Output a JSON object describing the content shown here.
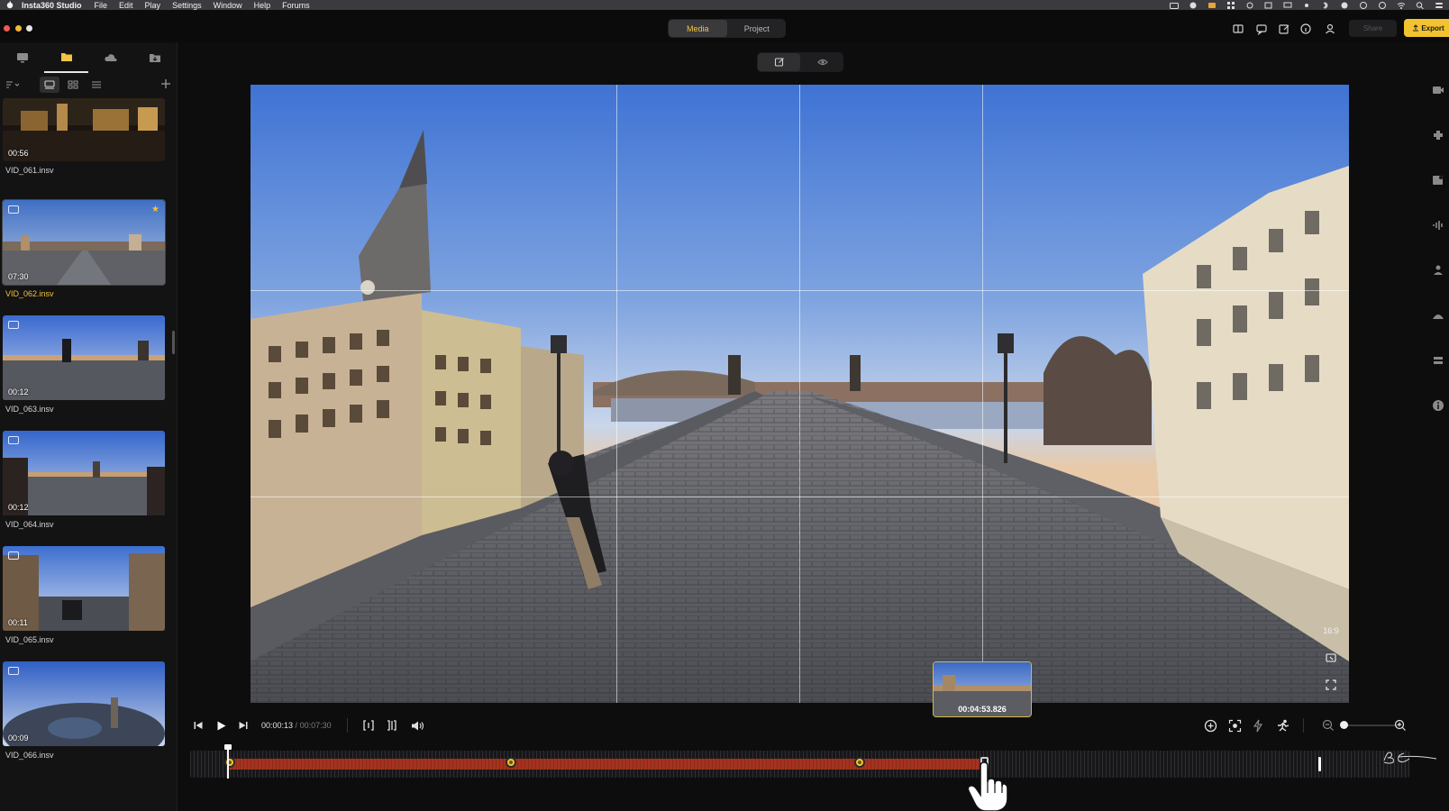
{
  "menubar": {
    "app_name": "Insta360 Studio",
    "items": [
      "File",
      "Edit",
      "Play",
      "Settings",
      "Window",
      "Help",
      "Forums"
    ]
  },
  "titlebar": {
    "tabs": [
      {
        "label": "Media",
        "active": true
      },
      {
        "label": "Project",
        "active": false
      }
    ],
    "share_label": "Share",
    "export_label": "Export"
  },
  "clips": [
    {
      "name": "VID_061.insv",
      "duration": "00:56",
      "selected": false,
      "starred": false
    },
    {
      "name": "VID_062.insv",
      "duration": "07:30",
      "selected": true,
      "starred": true
    },
    {
      "name": "VID_063.insv",
      "duration": "00:12",
      "selected": false,
      "starred": false
    },
    {
      "name": "VID_064.insv",
      "duration": "00:12",
      "selected": false,
      "starred": false
    },
    {
      "name": "VID_065.insv",
      "duration": "00:11",
      "selected": false,
      "starred": false
    },
    {
      "name": "VID_066.insv",
      "duration": "00:09",
      "selected": false,
      "starred": false
    }
  ],
  "viewer": {
    "aspect_label": "16:9"
  },
  "playback": {
    "current_time": "00:00:13",
    "separator": " / ",
    "total_time": "00:07:30",
    "hover_time": "00:04:53.826"
  },
  "colors": {
    "accent": "#f3c230",
    "timeline_range": "#a5321f",
    "panel_bg": "#131314"
  }
}
